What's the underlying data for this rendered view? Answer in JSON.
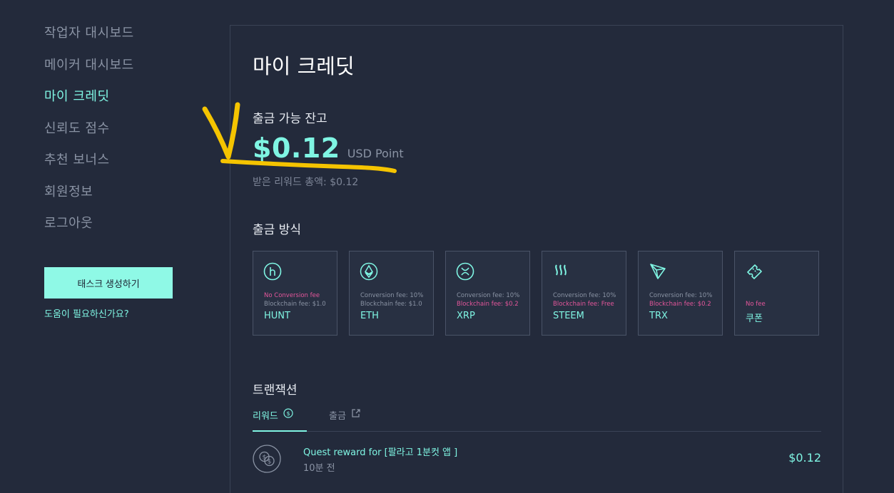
{
  "sidebar": {
    "items": [
      {
        "label": "작업자 대시보드"
      },
      {
        "label": "메이커 대시보드"
      },
      {
        "label": "마이 크레딧"
      },
      {
        "label": "신뢰도 점수"
      },
      {
        "label": "추천 보너스"
      },
      {
        "label": "회원정보"
      },
      {
        "label": "로그아웃"
      }
    ],
    "active_index": 2,
    "create_button": "태스크 생성하기",
    "help_link": "도움이 필요하신가요?"
  },
  "main": {
    "title": "마이 크레딧",
    "balance_label": "출금 가능 잔고",
    "balance_amount": "$0.12",
    "balance_unit": "USD Point",
    "total_rewards": "받은 리워드 총액: $0.12",
    "withdraw_title": "출금 방식",
    "methods": [
      {
        "icon": "hunt-icon",
        "fee1": "No Conversion fee",
        "fee2": "Blockchain fee: $1.0",
        "name": "HUNT",
        "fee1_highlight": true,
        "fee2_highlight": false
      },
      {
        "icon": "eth-icon",
        "fee1": "Conversion fee: 10%",
        "fee2": "Blockchain fee: $1.0",
        "name": "ETH",
        "fee1_highlight": false,
        "fee2_highlight": false
      },
      {
        "icon": "xrp-icon",
        "fee1": "Conversion fee: 10%",
        "fee2": "Blockchain fee: $0.2",
        "name": "XRP",
        "fee1_highlight": false,
        "fee2_highlight": true
      },
      {
        "icon": "steem-icon",
        "fee1": "Conversion fee: 10%",
        "fee2": "Blockchain fee: Free",
        "name": "STEEM",
        "fee1_highlight": false,
        "fee2_highlight": true
      },
      {
        "icon": "trx-icon",
        "fee1": "Conversion fee: 10%",
        "fee2": "Blockchain fee: $0.2",
        "name": "TRX",
        "fee1_highlight": false,
        "fee2_highlight": true
      },
      {
        "icon": "coupon-icon",
        "fee1": "",
        "fee2": "No fee",
        "name": "쿠폰",
        "fee1_highlight": false,
        "fee2_highlight": true
      }
    ],
    "transactions_title": "트랜잭션",
    "tabs": [
      {
        "label": "리워드",
        "icon": "dollar-circle-icon"
      },
      {
        "label": "출금",
        "icon": "export-icon"
      }
    ],
    "transactions": [
      {
        "name": "Quest reward for [팔라고 1분컷 앱 ]",
        "time": "10분 전",
        "amount": "$0.12",
        "icon": "coins-icon"
      }
    ]
  },
  "colors": {
    "background": "#232a3b",
    "accent": "#7ff5e3",
    "muted": "#8a93a4",
    "pink": "#e4569b",
    "annotation": "#f5c400"
  }
}
